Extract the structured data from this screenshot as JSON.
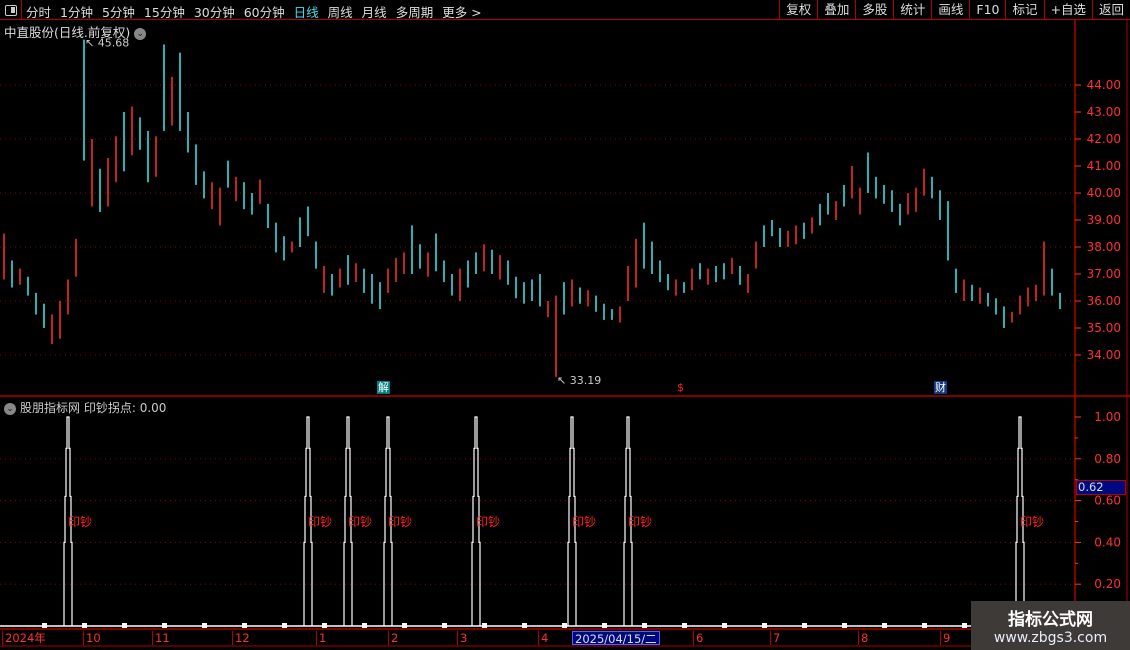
{
  "toolbar": {
    "periods": [
      "分时",
      "1分钟",
      "5分钟",
      "15分钟",
      "30分钟",
      "60分钟",
      "日线",
      "周线",
      "月线",
      "多周期",
      "更多 >"
    ],
    "active_period": "日线",
    "right_buttons": [
      "复权",
      "叠加",
      "多股",
      "统计",
      "画线",
      "F10",
      "标记",
      "+自选",
      "返回"
    ]
  },
  "main": {
    "title": "中直股份(日线.前复权)",
    "high_label": "45.68",
    "low_label": "33.19",
    "markers": [
      {
        "text": "解",
        "bg": "#008080",
        "fg": "#ffffff"
      },
      {
        "text": "$",
        "bg": "transparent",
        "fg": "#ff2020"
      },
      {
        "text": "财",
        "bg": "#103a80",
        "fg": "#ffffff"
      }
    ]
  },
  "indicator": {
    "title": "股朋指标网",
    "value_label": "印钞拐点: 0.00",
    "signal_text": "印钞",
    "current_value": "0.62"
  },
  "dates": {
    "labels": [
      "2024年",
      "10",
      "11",
      "12",
      "1",
      "2",
      "3",
      "4",
      "6",
      "7",
      "8",
      "9"
    ],
    "selected": "2025/04/15/二"
  },
  "watermark": {
    "line1": "指标公式网",
    "line2": "www.zbgs3.com"
  },
  "colors": {
    "up": "#ff3030",
    "down": "#40e8f0",
    "grid": "#900000",
    "axis": "#ff3030",
    "border": "#b00000"
  },
  "chart_data": {
    "type": "candlestick",
    "price_axis": {
      "ticks": [
        44,
        43,
        42,
        41,
        40,
        39,
        38,
        37,
        36,
        35,
        34
      ],
      "labels": [
        "44.00",
        "43.00",
        "42.00",
        "41.00",
        "40.00",
        "39.00",
        "38.00",
        "37.00",
        "36.00",
        "35.00",
        "34.00"
      ],
      "range": [
        33,
        45.9
      ]
    },
    "bars": [
      [
        38.5,
        36.8,
        1
      ],
      [
        37.5,
        36.5,
        0
      ],
      [
        37.2,
        36.6,
        1
      ],
      [
        36.9,
        36.2,
        0
      ],
      [
        36.3,
        35.5,
        0
      ],
      [
        35.9,
        35.0,
        0
      ],
      [
        35.5,
        34.4,
        1
      ],
      [
        36.0,
        34.6,
        1
      ],
      [
        36.8,
        35.5,
        1
      ],
      [
        38.3,
        36.9,
        1
      ],
      [
        45.68,
        41.2,
        0
      ],
      [
        42.0,
        39.5,
        1
      ],
      [
        40.9,
        39.3,
        0
      ],
      [
        41.3,
        39.5,
        1
      ],
      [
        42.1,
        40.4,
        1
      ],
      [
        43.0,
        40.8,
        0
      ],
      [
        43.2,
        41.4,
        1
      ],
      [
        42.8,
        41.6,
        0
      ],
      [
        42.3,
        40.4,
        0
      ],
      [
        42.1,
        40.6,
        1
      ],
      [
        45.5,
        42.3,
        0
      ],
      [
        44.3,
        42.5,
        1
      ],
      [
        45.2,
        42.3,
        0
      ],
      [
        43.0,
        41.5,
        0
      ],
      [
        41.8,
        40.3,
        0
      ],
      [
        40.8,
        39.8,
        0
      ],
      [
        40.4,
        39.4,
        1
      ],
      [
        40.2,
        38.8,
        1
      ],
      [
        41.2,
        40.2,
        0
      ],
      [
        40.6,
        39.7,
        1
      ],
      [
        40.4,
        39.4,
        0
      ],
      [
        40.0,
        39.2,
        0
      ],
      [
        40.5,
        39.6,
        1
      ],
      [
        39.6,
        38.7,
        0
      ],
      [
        38.9,
        37.8,
        0
      ],
      [
        38.4,
        37.5,
        0
      ],
      [
        38.2,
        37.8,
        1
      ],
      [
        39.1,
        38.0,
        0
      ],
      [
        39.5,
        38.4,
        0
      ],
      [
        38.2,
        37.2,
        0
      ],
      [
        37.3,
        36.3,
        1
      ],
      [
        37.0,
        36.2,
        0
      ],
      [
        37.2,
        36.5,
        1
      ],
      [
        37.7,
        36.6,
        0
      ],
      [
        37.4,
        36.7,
        1
      ],
      [
        37.2,
        36.3,
        0
      ],
      [
        37.0,
        35.9,
        0
      ],
      [
        36.7,
        35.7,
        0
      ],
      [
        37.2,
        36.3,
        1
      ],
      [
        37.6,
        36.7,
        1
      ],
      [
        37.8,
        37.0,
        1
      ],
      [
        38.8,
        37.0,
        0
      ],
      [
        38.1,
        37.2,
        0
      ],
      [
        37.8,
        36.9,
        1
      ],
      [
        38.5,
        37.1,
        0
      ],
      [
        37.5,
        36.7,
        0
      ],
      [
        37.0,
        36.2,
        0
      ],
      [
        37.2,
        36.0,
        1
      ],
      [
        37.5,
        36.5,
        0
      ],
      [
        37.8,
        37.0,
        0
      ],
      [
        38.1,
        37.1,
        1
      ],
      [
        37.9,
        37.0,
        0
      ],
      [
        37.7,
        36.8,
        1
      ],
      [
        37.5,
        36.6,
        0
      ],
      [
        36.9,
        36.1,
        0
      ],
      [
        36.7,
        35.9,
        0
      ],
      [
        36.8,
        36.0,
        0
      ],
      [
        37.0,
        35.8,
        0
      ],
      [
        36.0,
        35.4,
        1
      ],
      [
        36.2,
        33.19,
        1
      ],
      [
        36.7,
        35.5,
        0
      ],
      [
        36.8,
        35.8,
        1
      ],
      [
        36.5,
        35.9,
        0
      ],
      [
        36.4,
        35.8,
        1
      ],
      [
        36.2,
        35.6,
        0
      ],
      [
        35.9,
        35.3,
        0
      ],
      [
        35.7,
        35.3,
        0
      ],
      [
        35.8,
        35.2,
        1
      ],
      [
        37.3,
        36.0,
        1
      ],
      [
        38.3,
        36.5,
        1
      ],
      [
        38.9,
        37.2,
        0
      ],
      [
        38.2,
        37.0,
        0
      ],
      [
        37.5,
        36.7,
        0
      ],
      [
        37.0,
        36.4,
        0
      ],
      [
        36.8,
        36.2,
        1
      ],
      [
        36.7,
        36.3,
        0
      ],
      [
        37.2,
        36.4,
        1
      ],
      [
        37.4,
        36.8,
        0
      ],
      [
        37.2,
        36.6,
        1
      ],
      [
        37.3,
        36.7,
        0
      ],
      [
        37.4,
        36.8,
        0
      ],
      [
        37.6,
        37.0,
        1
      ],
      [
        37.3,
        36.6,
        0
      ],
      [
        37.0,
        36.3,
        1
      ],
      [
        38.2,
        37.2,
        1
      ],
      [
        38.8,
        38.0,
        0
      ],
      [
        39.0,
        38.4,
        0
      ],
      [
        38.7,
        38.0,
        0
      ],
      [
        38.6,
        38.0,
        1
      ],
      [
        38.8,
        38.1,
        1
      ],
      [
        38.9,
        38.3,
        0
      ],
      [
        39.1,
        38.5,
        1
      ],
      [
        39.6,
        38.8,
        0
      ],
      [
        40.0,
        39.2,
        0
      ],
      [
        39.7,
        39.0,
        1
      ],
      [
        40.3,
        39.5,
        0
      ],
      [
        41.0,
        39.8,
        1
      ],
      [
        40.2,
        39.2,
        1
      ],
      [
        41.5,
        40.0,
        0
      ],
      [
        40.6,
        39.8,
        0
      ],
      [
        40.3,
        39.6,
        0
      ],
      [
        40.1,
        39.3,
        0
      ],
      [
        39.6,
        38.8,
        0
      ],
      [
        40.0,
        39.2,
        1
      ],
      [
        40.2,
        39.3,
        1
      ],
      [
        40.9,
        39.9,
        1
      ],
      [
        40.6,
        39.8,
        0
      ],
      [
        40.1,
        39.0,
        0
      ],
      [
        39.7,
        37.5,
        0
      ],
      [
        37.2,
        36.3,
        0
      ],
      [
        36.8,
        36.0,
        1
      ],
      [
        36.6,
        36.0,
        0
      ],
      [
        36.5,
        35.9,
        1
      ],
      [
        36.3,
        35.8,
        0
      ],
      [
        36.1,
        35.5,
        0
      ],
      [
        35.8,
        35.0,
        0
      ],
      [
        35.6,
        35.2,
        1
      ],
      [
        36.2,
        35.5,
        1
      ],
      [
        36.5,
        35.8,
        1
      ],
      [
        36.6,
        36.0,
        1
      ],
      [
        38.2,
        36.2,
        1
      ],
      [
        37.2,
        36.2,
        0
      ],
      [
        36.3,
        35.7,
        0
      ]
    ],
    "indicator": {
      "name": "印钞拐点",
      "axis_ticks": [
        1.0,
        0.8,
        0.6,
        0.4,
        0.2
      ],
      "axis_labels": [
        "1.00",
        "0.80",
        "0.60",
        "0.40",
        "0.20"
      ],
      "range": [
        0,
        1
      ],
      "signal_bars": [
        8,
        38,
        43,
        48,
        59,
        71,
        78,
        127
      ],
      "signal_value": 1
    }
  }
}
